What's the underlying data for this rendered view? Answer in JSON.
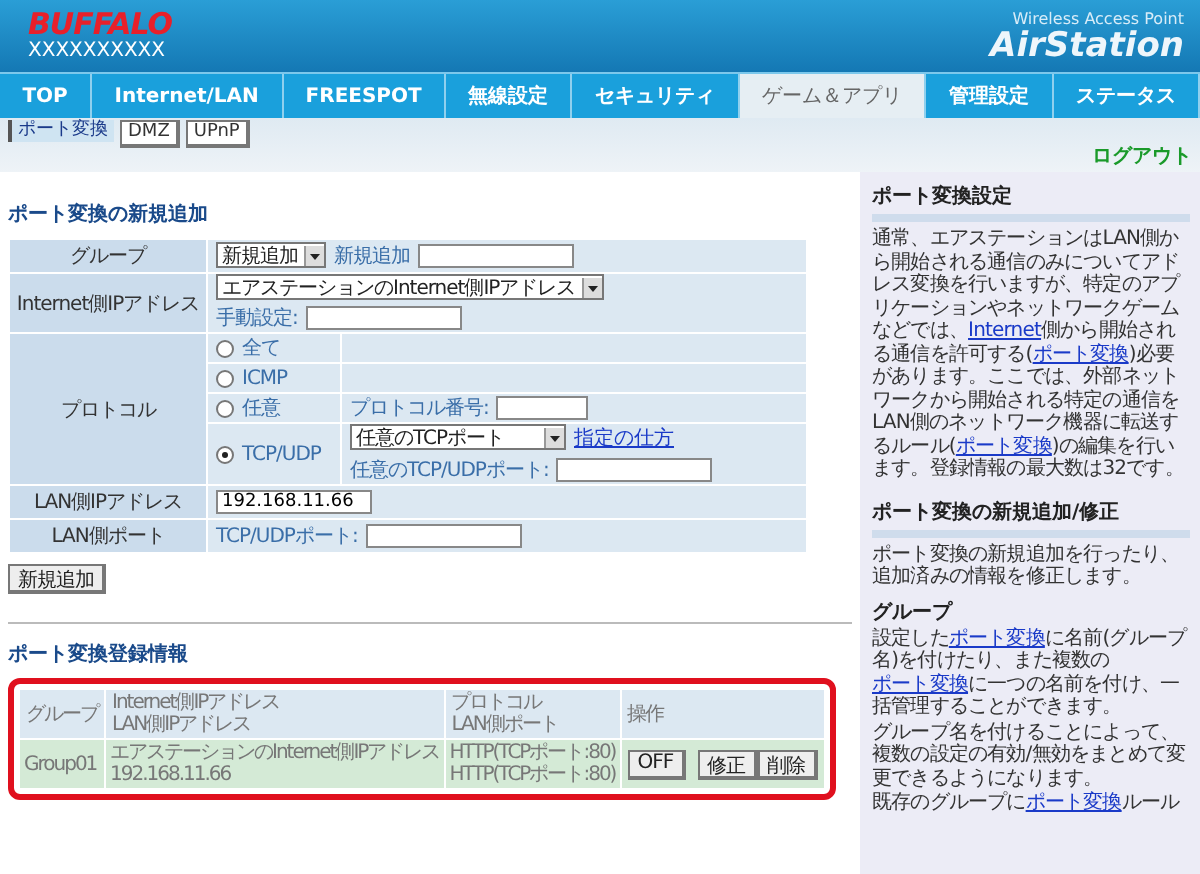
{
  "header": {
    "logo": "BUFFALO",
    "model": "XXXXXXXXXX",
    "product_caption": "Wireless Access Point",
    "product_name": "AirStation"
  },
  "tabs": [
    {
      "label": "TOP",
      "selected": false
    },
    {
      "label": "Internet/LAN",
      "selected": false
    },
    {
      "label": "FREESPOT",
      "selected": false
    },
    {
      "label": "無線設定",
      "selected": false
    },
    {
      "label": "セキュリティ",
      "selected": false
    },
    {
      "label": "ゲーム＆アプリ",
      "selected": true
    },
    {
      "label": "管理設定",
      "selected": false
    },
    {
      "label": "ステータス",
      "selected": false
    }
  ],
  "subtabs": [
    {
      "label": "ポート変換",
      "selected": true
    },
    {
      "label": "DMZ",
      "selected": false
    },
    {
      "label": "UPnP",
      "selected": false
    }
  ],
  "logout": "ログアウト",
  "new_entry": {
    "title": "ポート変換の新規追加",
    "group": {
      "label": "グループ",
      "select": "新規追加",
      "new_label": "新規追加"
    },
    "internet_ip": {
      "label": "Internet側IPアドレス",
      "select": "エアステーションのInternet側IPアドレス",
      "manual_label": "手動設定:"
    },
    "protocol": {
      "label": "プロトコル",
      "options": [
        {
          "kind": "plain",
          "label": "全て",
          "selected": false
        },
        {
          "kind": "plain",
          "label": "ICMP",
          "selected": false
        },
        {
          "kind": "number",
          "label": "任意",
          "selected": false,
          "field_label": "プロトコル番号:"
        },
        {
          "kind": "tcpudp",
          "label": "TCP/UDP",
          "selected": true,
          "select": "任意のTCPポート",
          "link": "指定の仕方",
          "field_label": "任意のTCP/UDPポート:"
        }
      ]
    },
    "lan_ip": {
      "label": "LAN側IPアドレス",
      "value": "192.168.11.66"
    },
    "lan_port": {
      "label": "LAN側ポート",
      "field_label": "TCP/UDPポート:"
    },
    "button": "新規追加"
  },
  "registered": {
    "title": "ポート変換登録情報",
    "columns": [
      [
        "グループ"
      ],
      [
        "Internet側IPアドレス",
        "LAN側IPアドレス"
      ],
      [
        "プロトコル",
        "LAN側ポート"
      ],
      [
        "操作"
      ]
    ],
    "rows": [
      {
        "group": "Group01",
        "addresses": [
          "エアステーションのInternet側IPアドレス",
          "192.168.11.66"
        ],
        "ports": [
          "HTTP(TCPポート:80)",
          "HTTP(TCPポート:80)"
        ],
        "toggle": "OFF",
        "actions": [
          "修正",
          "削除"
        ]
      }
    ]
  },
  "sidebar": [
    {
      "title": "ポート変換設定",
      "blocks": [
        {
          "kind": "para",
          "parts": [
            {
              "kind": "text",
              "text": "通常、エアステーションはLAN側から開始される通信のみについてアドレス変換を行いますが、特定のアプリケーションやネットワークゲームなどでは、"
            },
            {
              "kind": "link",
              "text": "Internet"
            },
            {
              "kind": "text",
              "text": "側から開始される通信を許可する("
            },
            {
              "kind": "link",
              "text": "ポート変換"
            },
            {
              "kind": "text",
              "text": ")必要があります。ここでは、外部ネットワークから開始される特定の通信をLAN側のネットワーク機器に転送するルール("
            },
            {
              "kind": "link",
              "text": "ポート変換"
            },
            {
              "kind": "text",
              "text": ")の編集を行います。登録情報の最大数は32です。"
            }
          ]
        }
      ]
    },
    {
      "title": "ポート変換の新規追加/修正",
      "blocks": [
        {
          "kind": "para",
          "parts": [
            {
              "kind": "text",
              "text": "ポート変換の新規追加を行ったり、追加済みの情報を修正します。"
            }
          ]
        },
        {
          "kind": "heading",
          "parts": [
            {
              "kind": "text",
              "text": "グループ"
            }
          ]
        },
        {
          "kind": "para",
          "parts": [
            {
              "kind": "text",
              "text": "設定した"
            },
            {
              "kind": "link",
              "text": "ポート変換"
            },
            {
              "kind": "text",
              "text": "に名前(グループ名)を付けたり、また複数の"
            },
            {
              "kind": "link",
              "text": "ポート変換"
            },
            {
              "kind": "text",
              "text": "に一つの名前を付け、一括管理することができます。"
            }
          ]
        },
        {
          "kind": "para",
          "parts": [
            {
              "kind": "text",
              "text": "グループ名を付けることによって、複数の設定の有効/無効をまとめて変更できるようになります。"
            }
          ]
        },
        {
          "kind": "para",
          "parts": [
            {
              "kind": "text",
              "text": "既存のグループに"
            },
            {
              "kind": "link",
              "text": "ポート変換"
            },
            {
              "kind": "text",
              "text": "ルール"
            }
          ]
        }
      ]
    }
  ]
}
